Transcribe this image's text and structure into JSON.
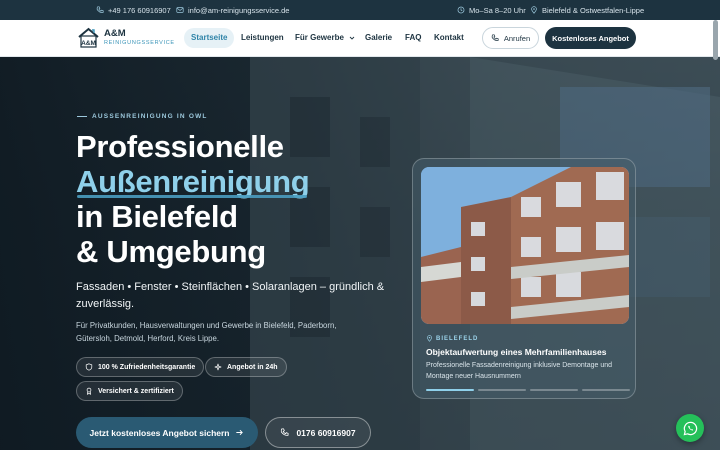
{
  "topbar": {
    "phone": "+49 176 60916907",
    "email": "info@am-reinigungsservice.de",
    "hours": "Mo–Sa 8–20 Uhr",
    "region": "Bielefeld & Ostwestfalen-Lippe"
  },
  "logo": {
    "name": "A&M",
    "tagline": "REINIGUNGSSERVICE"
  },
  "nav": {
    "items": [
      "Startseite",
      "Leistungen",
      "Für Gewerbe",
      "Galerie",
      "FAQ",
      "Kontakt"
    ],
    "call_label": "Anrufen",
    "quote_label": "Kostenloses Angebot"
  },
  "hero": {
    "eyebrow": "AUSSENREINIGUNG IN OWL",
    "title_line1": "Professionelle",
    "title_line2": "Außenreinigung",
    "title_line3": "in Bielefeld",
    "title_line4": "& Umgebung",
    "lead": "Fassaden • Fenster • Steinflächen • Solaranlagen – gründlich & zuverlässig.",
    "sub": "Für Privatkunden, Hausverwaltungen und Gewerbe in Bielefeld, Paderborn, Gütersloh, Detmold, Herford, Kreis Lippe.",
    "badges": [
      "100 % Zufriedenheitsgarantie",
      "Angebot in 24h",
      "Versichert & zertifiziert"
    ],
    "cta_primary": "Jetzt kostenloses Angebot sichern",
    "cta_phone": "0176 60916907"
  },
  "card": {
    "location": "BIELEFELD",
    "title": "Objektaufwertung eines Mehrfamilienhauses",
    "text": "Professionelle Fassadenreinigung inklusive Demontage und Montage neuer Hausnummern",
    "active_slide": 1,
    "slide_count": 4
  },
  "icons": {
    "phone": "phone-icon",
    "mail": "mail-icon",
    "clock": "clock-icon",
    "pin": "pin-icon",
    "shield": "shield-icon",
    "sparkle": "sparkle-icon",
    "award": "award-icon",
    "arrow": "arrow-right-icon",
    "whatsapp": "whatsapp-icon"
  },
  "colors": {
    "brand_dark": "#1d3340",
    "accent": "#8fd0ea",
    "whatsapp": "#25c05a"
  }
}
